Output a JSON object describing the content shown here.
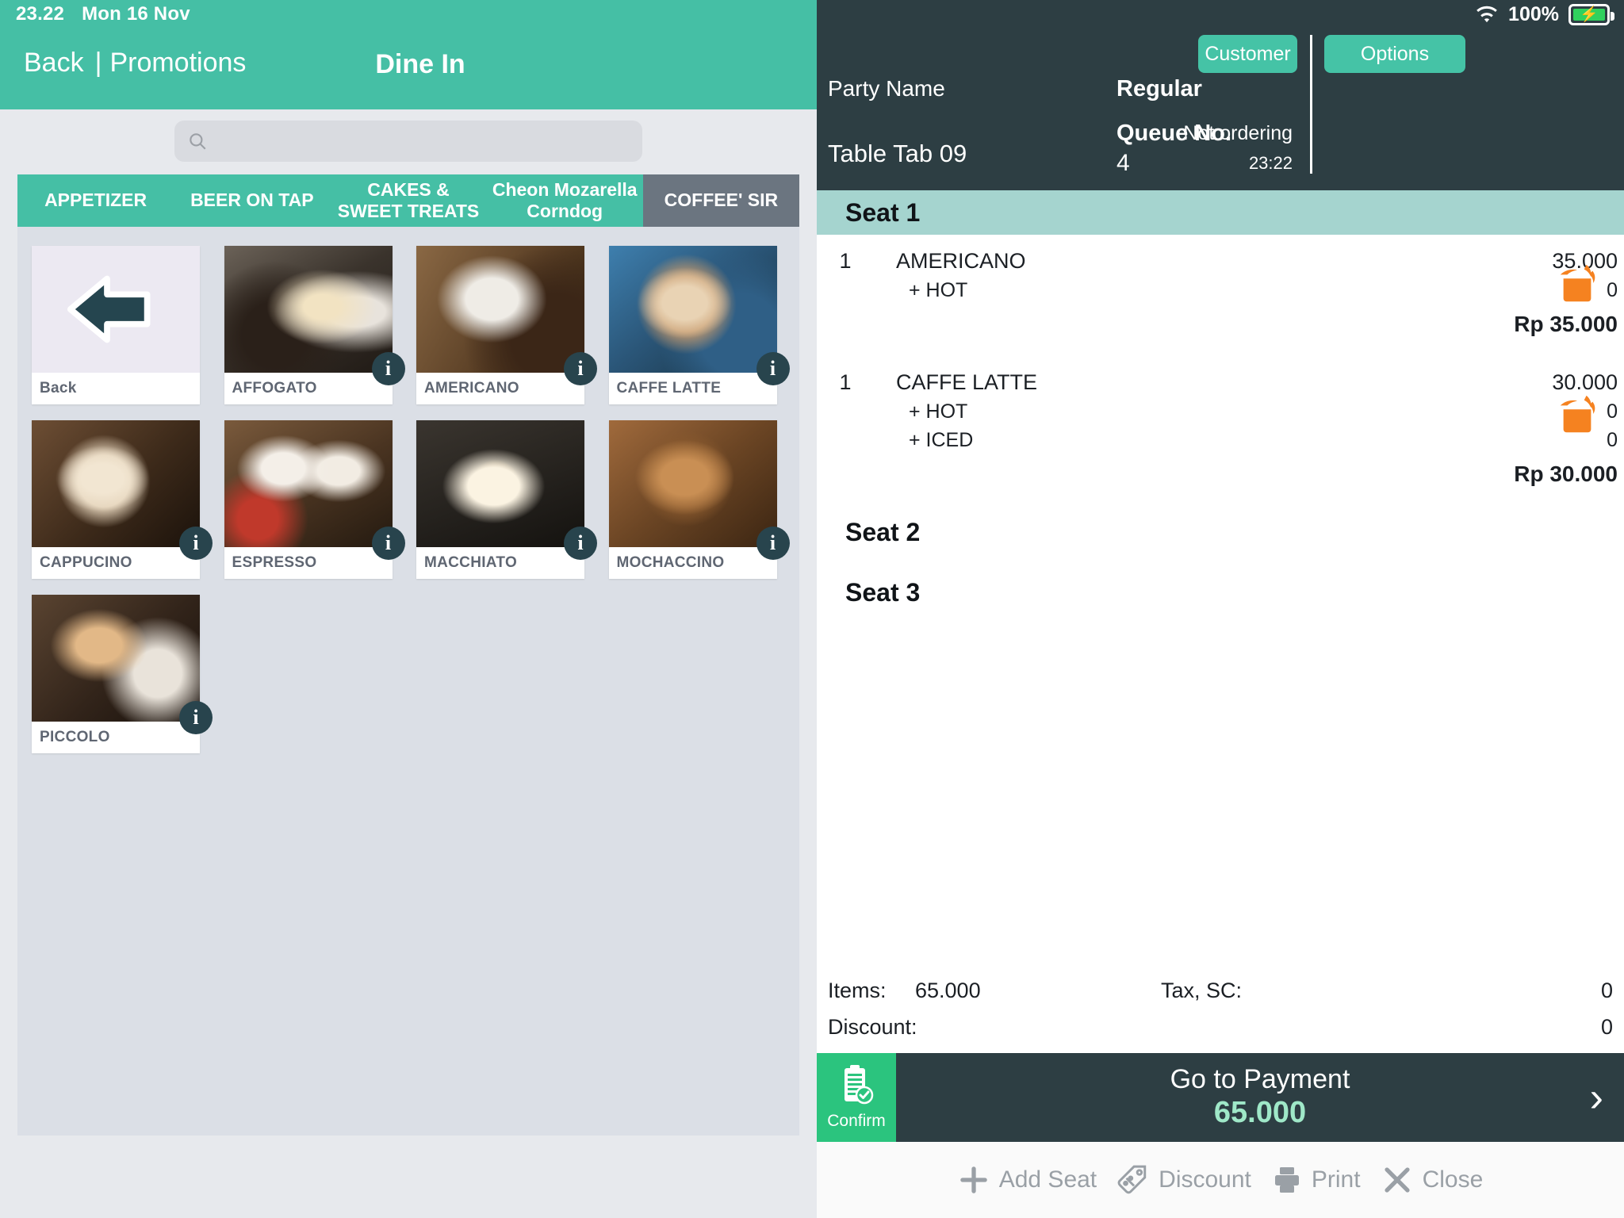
{
  "statusbar_left": {
    "time": "23.22",
    "date": "Mon 16 Nov"
  },
  "nav": {
    "back": "Back",
    "separator": "|",
    "promotions": "Promotions",
    "title": "Dine In"
  },
  "search": {
    "value": "",
    "placeholder": "",
    "icon": "search-icon"
  },
  "tabs": [
    {
      "label": "APPETIZER",
      "active": false
    },
    {
      "label": "BEER ON TAP",
      "active": false
    },
    {
      "label": "CAKES & SWEET TREATS",
      "active": false
    },
    {
      "label": "Cheon Mozarella Corndog",
      "active": false
    },
    {
      "label": "COFFEE' SIR",
      "active": true
    }
  ],
  "products": [
    {
      "label": "Back",
      "kind": "back",
      "info": false,
      "thumb": "back-arrow-icon"
    },
    {
      "label": "AFFOGATO",
      "kind": "item",
      "info": true,
      "thumb": "ph-affogato"
    },
    {
      "label": "AMERICANO",
      "kind": "item",
      "info": true,
      "thumb": "ph-americano"
    },
    {
      "label": "CAFFE LATTE",
      "kind": "item",
      "info": true,
      "thumb": "ph-caffelatte"
    },
    {
      "label": "CAPPUCINO",
      "kind": "item",
      "info": true,
      "thumb": "ph-cappucino"
    },
    {
      "label": "ESPRESSO",
      "kind": "item",
      "info": true,
      "thumb": "ph-espresso"
    },
    {
      "label": "MACCHIATO",
      "kind": "item",
      "info": true,
      "thumb": "ph-macchiato"
    },
    {
      "label": "MOCHACCINO",
      "kind": "item",
      "info": true,
      "thumb": "ph-mochaccino"
    },
    {
      "label": "PICCOLO",
      "kind": "item",
      "info": true,
      "thumb": "ph-piccolo"
    }
  ],
  "order_header": {
    "wifi_icon": "wifi-icon",
    "battery_percent": "100%",
    "battery_icon": "battery-charging-icon",
    "party_name_label": "Party Name",
    "customer_button": "Customer",
    "options_button": "Options",
    "regular_label": "Regular",
    "not_ordering_label": "Not ordering",
    "table_tab": "Table Tab 09",
    "table_time": "23:22",
    "queue_label": "Queue No.",
    "queue_value": "4"
  },
  "seats": [
    {
      "name": "Seat 1",
      "highlighted": true,
      "items": [
        {
          "qty": "1",
          "name": "AMERICANO",
          "price": "35.000",
          "modifiers": [
            {
              "label": "+  HOT",
              "price": "0"
            }
          ],
          "total": "Rp 35.000",
          "icon": "cooking-pot-icon"
        },
        {
          "qty": "1",
          "name": "CAFFE LATTE",
          "price": "30.000",
          "modifiers": [
            {
              "label": "+  HOT",
              "price": "0"
            },
            {
              "label": "+  ICED",
              "price": "0"
            }
          ],
          "total": "Rp 30.000",
          "icon": "cooking-pot-icon"
        }
      ]
    },
    {
      "name": "Seat 2",
      "highlighted": false,
      "items": []
    },
    {
      "name": "Seat 3",
      "highlighted": false,
      "items": []
    }
  ],
  "totals": {
    "items_label": "Items:",
    "items_value": "65.000",
    "tax_label": "Tax, SC:",
    "tax_value": "0",
    "discount_label": "Discount:",
    "discount_value": "0"
  },
  "payment": {
    "confirm_label": "Confirm",
    "confirm_icon": "clipboard-check-icon",
    "go_to_payment_label": "Go to Payment",
    "amount": "65.000",
    "chevron_icon": "chevron-right-icon"
  },
  "toolbar": [
    {
      "label": "Add Seat",
      "icon": "plus-icon"
    },
    {
      "label": "Discount",
      "icon": "tag-icon"
    },
    {
      "label": "Print",
      "icon": "printer-icon"
    },
    {
      "label": "Close",
      "icon": "close-icon"
    }
  ],
  "colors": {
    "teal_header": "#45bfa5",
    "dark_panel": "#2d3e43",
    "seat_highlight": "#a5d4cf",
    "active_tab": "#6b7580",
    "confirm_green": "#2bc47e",
    "amount_mint": "#9fe8c8",
    "pot_orange": "#f58220",
    "info_badge": "#28444d"
  }
}
